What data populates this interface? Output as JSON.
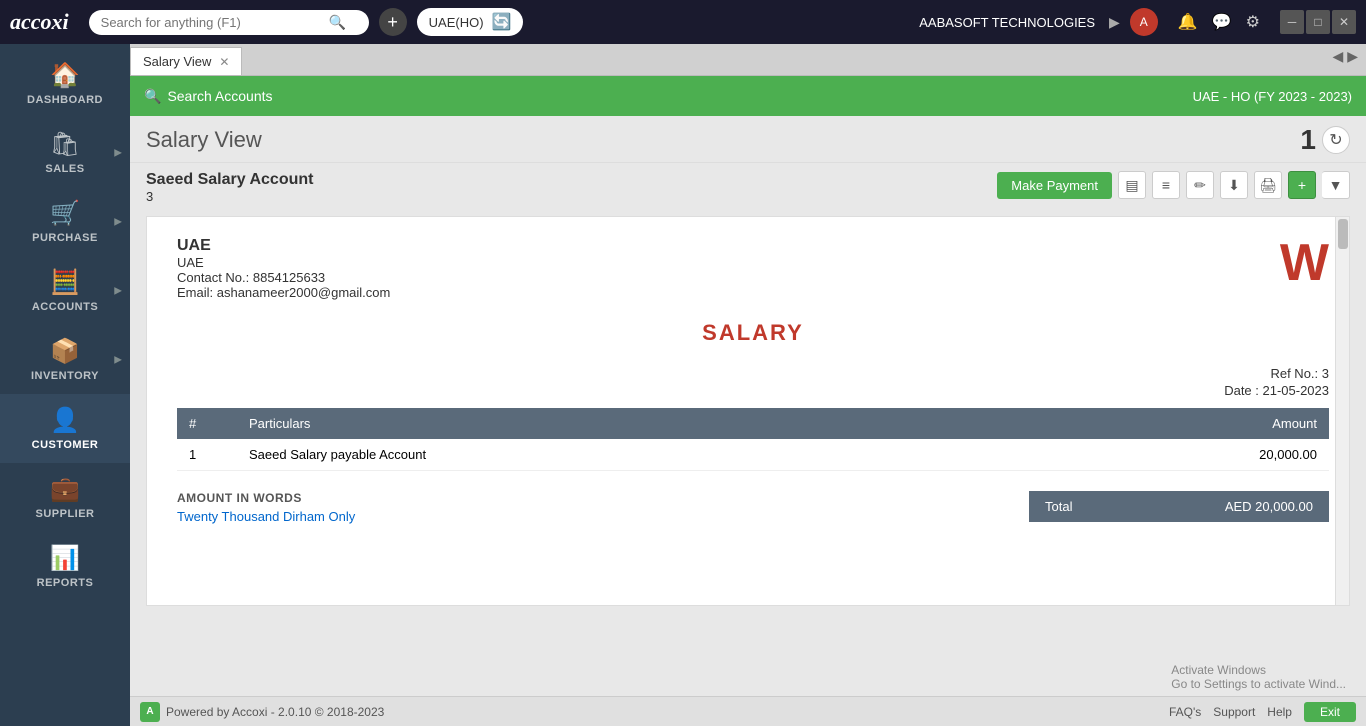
{
  "topbar": {
    "logo": "accoxi",
    "search_placeholder": "Search for anything (F1)",
    "branch": "UAE(HO)",
    "company": "AABASOFT TECHNOLOGIES",
    "user_initial": "A"
  },
  "sidebar": {
    "items": [
      {
        "label": "DASHBOARD",
        "icon": "🏠"
      },
      {
        "label": "SALES",
        "icon": "🛍"
      },
      {
        "label": "PURCHASE",
        "icon": "🛒"
      },
      {
        "label": "ACCOUNTS",
        "icon": "🧮"
      },
      {
        "label": "INVENTORY",
        "icon": "📦"
      },
      {
        "label": "CUSTOMER",
        "icon": "👤"
      },
      {
        "label": "SUPPLIER",
        "icon": "💼"
      },
      {
        "label": "REPORTS",
        "icon": "📊"
      }
    ]
  },
  "tab": {
    "label": "Salary View"
  },
  "header": {
    "search_accounts_label": "Search Accounts",
    "branch_fy": "UAE - HO (FY 2023 - 2023)"
  },
  "page": {
    "title": "Salary View",
    "number": "1",
    "account_name": "Saeed Salary Account",
    "account_number": "3",
    "make_payment_label": "Make Payment"
  },
  "document": {
    "company_name": "UAE",
    "company_country": "UAE",
    "contact": "Contact No.: 8854125633",
    "email": "Email: ashanameer2000@gmail.com",
    "doc_title": "SALARY",
    "ref_no": "Ref No.: 3",
    "date": "Date : 21-05-2023",
    "table": {
      "headers": [
        "#",
        "Particulars",
        "Amount"
      ],
      "rows": [
        {
          "num": "1",
          "particulars": "Saeed Salary payable Account",
          "amount": "20,000.00"
        }
      ]
    },
    "amount_in_words_label": "AMOUNT IN WORDS",
    "amount_in_words": "Twenty Thousand Dirham Only",
    "total_label": "Total",
    "total_amount": "AED 20,000.00"
  },
  "footer": {
    "powered_by": "Powered by Accoxi - 2.0.10 © 2018-2023",
    "faq": "FAQ's",
    "support": "Support",
    "help": "Help",
    "exit": "Exit"
  },
  "activate_windows": "Activate Windows\nGo to Settings to activate Wind..."
}
